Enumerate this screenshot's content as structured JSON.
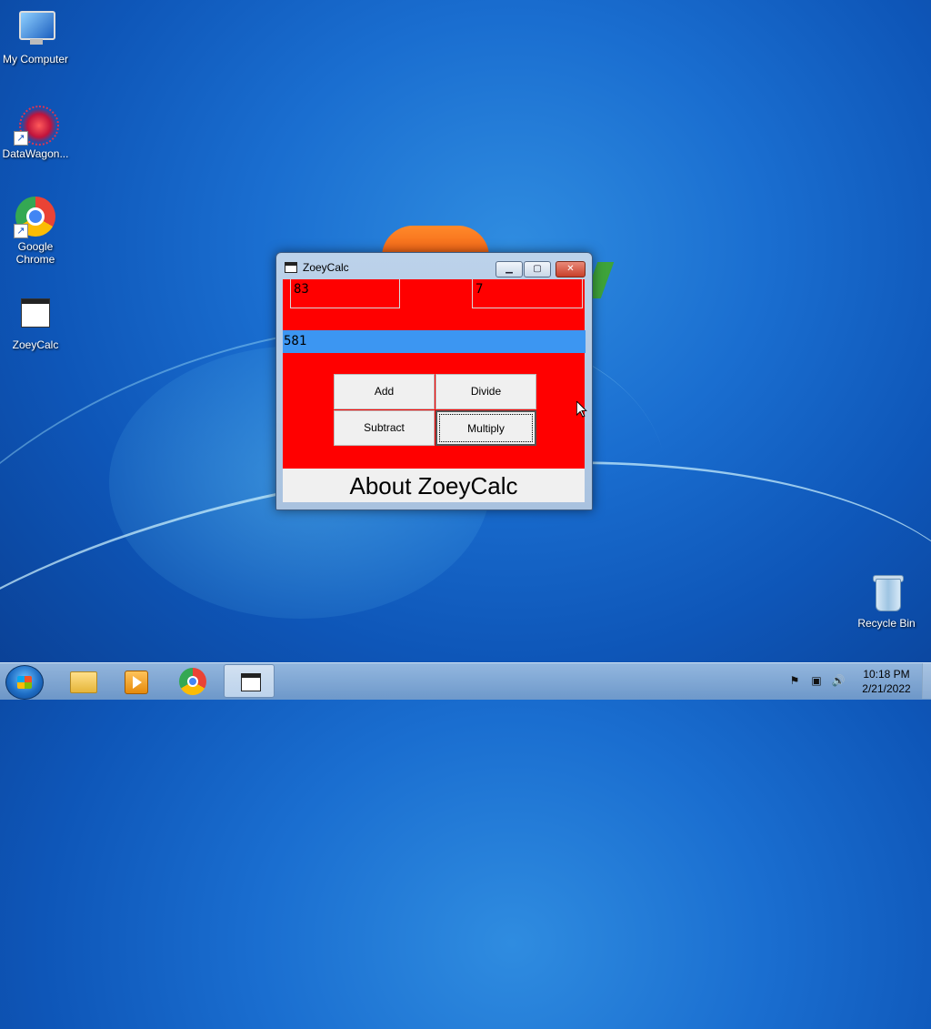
{
  "desktop": {
    "icons": [
      {
        "label": "My Computer",
        "icon": "computer-icon"
      },
      {
        "label": "DataWagon...",
        "icon": "datawagon-icon"
      },
      {
        "label": "Google Chrome",
        "icon": "chrome-icon"
      },
      {
        "label": "ZoeyCalc",
        "icon": "app-window-icon"
      },
      {
        "label": "Recycle Bin",
        "icon": "recycle-bin-icon"
      }
    ]
  },
  "window": {
    "title": "ZoeyCalc",
    "controls": {
      "minimize": "▁",
      "maximize": "▢",
      "close": "✕"
    },
    "input_a": "83",
    "input_b": "7",
    "result": "581",
    "buttons": {
      "add": "Add",
      "divide": "Divide",
      "subtract": "Subtract",
      "multiply": "Multiply"
    },
    "about": "About ZoeyCalc",
    "colors": {
      "panel": "#ff0000",
      "result_bar": "#3c96f2"
    }
  },
  "taskbar": {
    "pinned": [
      "start-icon",
      "explorer-icon",
      "media-player-icon",
      "chrome-icon",
      "zoeycalc-icon"
    ],
    "tray": {
      "flag": "⚑",
      "network": "▣",
      "volume": "🔊"
    },
    "time": "10:18 PM",
    "date": "2/21/2022"
  }
}
